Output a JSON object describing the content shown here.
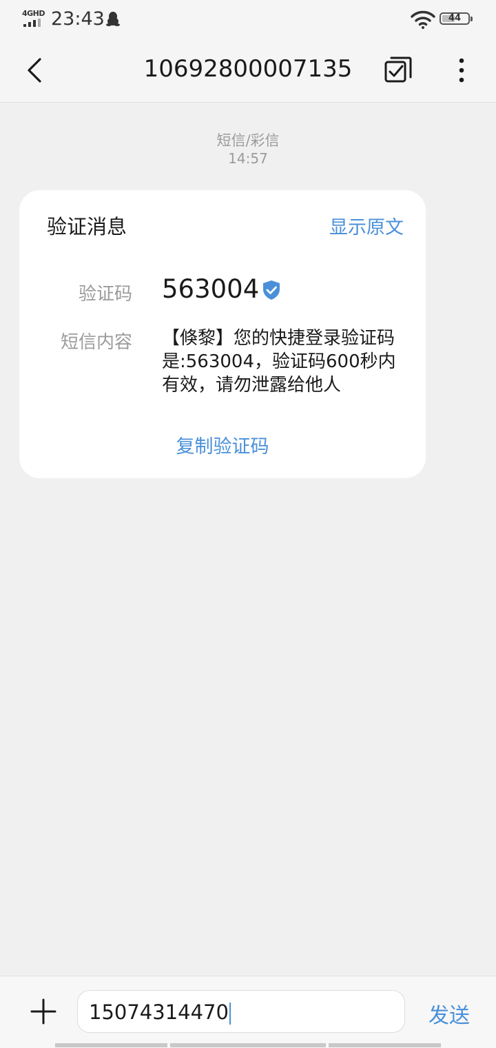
{
  "status_bar": {
    "network": "4GHD",
    "time": "23:43",
    "notification_icon": "qq-penguin-icon",
    "wifi_icon": "wifi-icon",
    "battery_level": "44"
  },
  "header": {
    "back_icon": "chevron-left-icon",
    "title": "10692800007135",
    "select_icon": "checkbox-select-icon",
    "more_icon": "more-vertical-icon"
  },
  "conversation": {
    "message_type": "短信/彩信",
    "timestamp": "14:57"
  },
  "verification_card": {
    "title": "验证消息",
    "show_original_label": "显示原文",
    "code_label": "验证码",
    "code_value": "563004",
    "verified_icon": "verified-shield-icon",
    "content_label": "短信内容",
    "content_text": "【倏黎】您的快捷登录验证码是:563004，验证码600秒内有效，请勿泄露给他人",
    "copy_button_label": "复制验证码"
  },
  "composer": {
    "add_icon": "plus-icon",
    "input_value": "15074314470",
    "send_label": "发送"
  },
  "colors": {
    "accent": "#4a90d9",
    "background": "#f0f0f0",
    "card": "#ffffff",
    "secondary_text": "#9b9b9b"
  }
}
